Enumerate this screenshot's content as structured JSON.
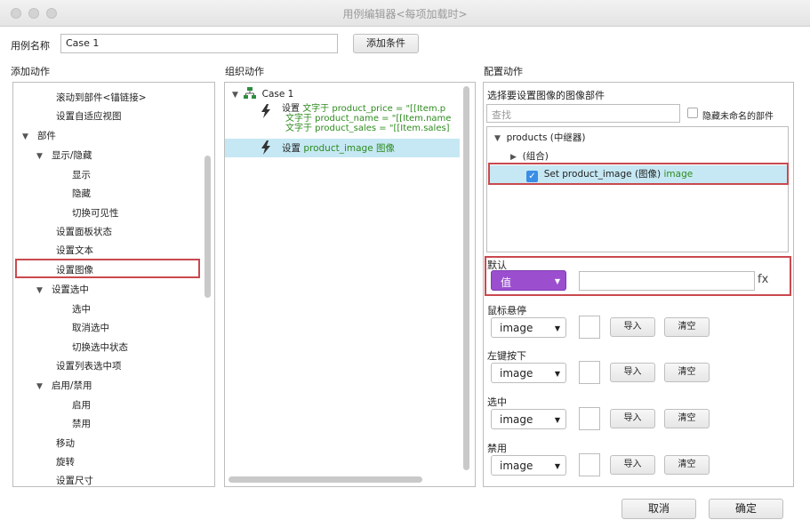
{
  "window": {
    "title": "用例编辑器<每项加载时>"
  },
  "case_name": {
    "label": "用例名称",
    "value": "Case 1",
    "add_condition": "添加条件"
  },
  "sections": {
    "add_action": "添加动作",
    "organize_action": "组织动作",
    "config_action": "配置动作"
  },
  "action_tree": [
    {
      "label": "滚动到部件<锚链接>"
    },
    {
      "label": "设置自适应视图"
    },
    {
      "label": "部件"
    },
    {
      "label": "显示/隐藏"
    },
    {
      "label": "显示"
    },
    {
      "label": "隐藏"
    },
    {
      "label": "切换可见性"
    },
    {
      "label": "设置面板状态"
    },
    {
      "label": "设置文本"
    },
    {
      "label": "设置图像"
    },
    {
      "label": "设置选中"
    },
    {
      "label": "选中"
    },
    {
      "label": "取消选中"
    },
    {
      "label": "切换选中状态"
    },
    {
      "label": "设置列表选中项"
    },
    {
      "label": "启用/禁用"
    },
    {
      "label": "启用"
    },
    {
      "label": "禁用"
    },
    {
      "label": "移动"
    },
    {
      "label": "旋转"
    },
    {
      "label": "设置尺寸"
    }
  ],
  "organize": {
    "case_label": "Case 1",
    "set1_prefix": "设置",
    "set1_line1": "文字于 product_price = \"[[Item.p",
    "set1_line2": "文字于 product_name = \"[[Item.name",
    "set1_line3": "文字于 product_sales = \"[[Item.sales]",
    "set2_prefix": "设置",
    "set2_text": "product_image 图像"
  },
  "config": {
    "select_label": "选择要设置图像的图像部件",
    "search_placeholder": "查找",
    "hide_unnamed": "隐藏未命名的部件",
    "widget_tree": {
      "products": "products (中继器)",
      "group": "(组合)",
      "set_item": "Set product_image (图像)",
      "set_item_green": "image"
    },
    "default_label": "默认",
    "default_value": "值",
    "fx": "fx",
    "states": [
      {
        "label": "鼠标悬停",
        "value": "image",
        "import": "导入",
        "clear": "清空"
      },
      {
        "label": "左键按下",
        "value": "image",
        "import": "导入",
        "clear": "清空"
      },
      {
        "label": "选中",
        "value": "image",
        "import": "导入",
        "clear": "清空"
      },
      {
        "label": "禁用",
        "value": "image",
        "import": "导入",
        "clear": "清空"
      }
    ]
  },
  "footer": {
    "cancel": "取消",
    "ok": "确定"
  },
  "colors": {
    "selection": "#c6e8f4",
    "highlight_border": "#c9494f",
    "value_dropdown": "#9b4fcf",
    "green_text": "#2e8b1f"
  }
}
